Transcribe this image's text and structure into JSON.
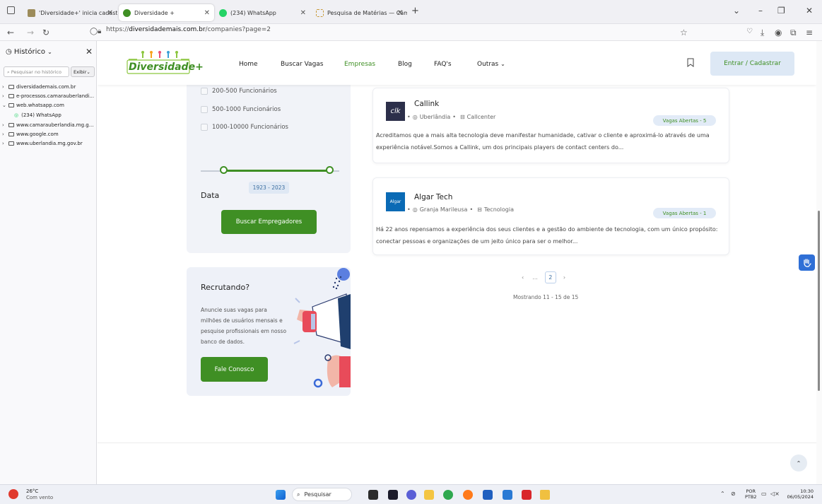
{
  "browser": {
    "tabs": [
      {
        "title": "'Diversidade+' inicia cadastro de",
        "active": false
      },
      {
        "title": "Diversidade +",
        "active": true
      },
      {
        "title": "(234) WhatsApp",
        "active": false
      },
      {
        "title": "Pesquisa de Matérias — Câmara",
        "active": false
      }
    ],
    "new_tab_symbol": "+",
    "url_prefix": "https://",
    "url_domain": "diversidademais.com.br",
    "url_path": "/companies?page=2"
  },
  "history_sidebar": {
    "title": "Histórico",
    "search_placeholder": "Pesquisar no histórico",
    "view_button": "Exibir",
    "items": [
      {
        "label": "diversidademais.com.br",
        "expanded": false
      },
      {
        "label": "e-processos.camarauberlandi...",
        "expanded": false
      },
      {
        "label": "web.whatsapp.com",
        "expanded": true
      },
      {
        "label": "(234) WhatsApp",
        "child": true
      },
      {
        "label": "www.camarauberlandia.mg.g...",
        "expanded": false
      },
      {
        "label": "www.google.com",
        "expanded": false
      },
      {
        "label": "www.uberlandia.mg.gov.br",
        "expanded": false
      }
    ]
  },
  "site": {
    "logo_text": "Diversidade",
    "logo_plus": "+",
    "nav": [
      "Home",
      "Buscar Vagas",
      "Empresas",
      "Blog",
      "FAQ's",
      "Outras"
    ],
    "login_button": "Entrar / Cadastrar",
    "accent": "#3f8f24"
  },
  "filters": {
    "size_options": [
      "200-500 Funcionários",
      "500-1000 Funcionários",
      "1000-10000 Funcionários"
    ],
    "data_label": "Data",
    "range_value": "1923 - 2023",
    "search_button": "Buscar Empregadores"
  },
  "recruit": {
    "title": "Recrutando?",
    "text": "Anuncie suas vagas para milhões de usuários mensais e pesquise profissionais em nosso banco de dados.",
    "button": "Fale Conosco"
  },
  "companies": [
    {
      "name": "Callink",
      "logo_text": "clk",
      "city": "Uberlândia",
      "sector": "Callcenter",
      "badge": "Vagas Abertas - 5",
      "description": "Acreditamos que a mais alta tecnologia deve manifestar humanidade, cativar o cliente e aproximá-lo através de uma experiência notável.Somos a Callink, um dos principais players de contact centers do..."
    },
    {
      "name": "Algar Tech",
      "logo_text": "Algar",
      "city": "Granja Marileusa",
      "sector": "Tecnologia",
      "badge": "Vagas Abertas - 1",
      "description": "Há 22 anos repensamos a experiência dos seus clientes e a gestão do ambiente de tecnologia, com um único propósito: conectar pessoas e organizações de um jeito único para ser o melhor..."
    }
  ],
  "pagination": {
    "prev": "‹",
    "ellipsis": "...",
    "current": "2",
    "next": "›",
    "showing": "Mostrando 11 - 15 de 15"
  },
  "taskbar": {
    "weather_temp": "26°C",
    "weather_desc": "Com vento",
    "search_label": "Pesquisar",
    "lang_line1": "POR",
    "lang_line2": "PTB2",
    "time": "10:30",
    "date": "06/05/2024"
  }
}
